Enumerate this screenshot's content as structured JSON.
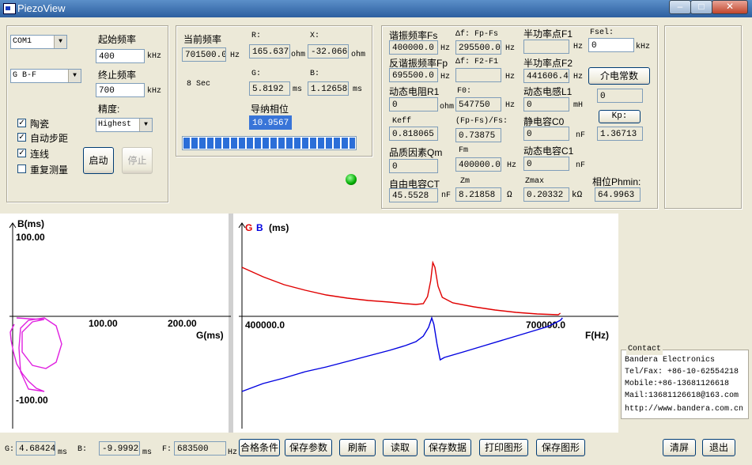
{
  "window": {
    "title": "PiezoView"
  },
  "controls": {
    "port": "COM1",
    "mode": "G B-F",
    "start_freq_label": "起始频率",
    "start_freq": "400",
    "end_freq_label": "终止频率",
    "end_freq": "700",
    "freq_unit": "kHz",
    "precision_label": "精度:",
    "precision": "Highest",
    "checks": [
      {
        "label": "陶瓷",
        "checked": true
      },
      {
        "label": "自动步距",
        "checked": true
      },
      {
        "label": "连线",
        "checked": true
      },
      {
        "label": "重复测量",
        "checked": false
      }
    ],
    "start_button": "启动",
    "stop_button": "停止"
  },
  "current": {
    "freq_label": "当前频率",
    "freq": "701500.0",
    "freq_unit": "Hz",
    "sec_label": "8 Sec",
    "r_label": "R:",
    "r": "165.637",
    "r_unit": "ohm",
    "x_label": "X:",
    "x": "-32.0667",
    "x_unit": "ohm",
    "g_label": "G:",
    "g": "5.8192",
    "g_unit": "ms",
    "b_label": "B:",
    "b": "1.12658",
    "b_unit": "ms",
    "phase_label": "导纳相位",
    "phase": "10.9567",
    "progress": 1.0
  },
  "results": {
    "fs_label": "谐振频率Fs",
    "fs": "400000.0",
    "fs_unit": "Hz",
    "df1_label": "Δf: Fp-Fs",
    "df1": "295500.0",
    "df1_unit": "Hz",
    "f1_label": "半功率点F1",
    "f1": "",
    "f1_unit": "Hz",
    "fsel_label": "Fsel:",
    "fsel": "0",
    "fsel_unit": "kHz",
    "fp_label": "反谐振频率Fp",
    "fp": "695500.0",
    "fp_unit": "Hz",
    "df2_label": "Δf: F2-F1",
    "df2": "",
    "df2_unit": "Hz",
    "f2_label": "半功率点F2",
    "f2": "441606.4",
    "f2_unit": "Hz",
    "dielectric_button": "介电常数",
    "r1_label": "动态电阻R1",
    "r1": "0",
    "r1_unit": "ohm",
    "f0_label": "F0:",
    "f0": "547750",
    "f0_unit": "Hz",
    "l1_label": "动态电感L1",
    "l1": "0",
    "l1_unit": "mH",
    "dielectric": "0",
    "keff_label": "Keff",
    "keff": "0.818065",
    "ratio_label": "(Fp-Fs)/Fs:",
    "ratio": "0.73875",
    "c0_label": "静电容C0",
    "c0": "0",
    "c0_unit": "nF",
    "kp_button": "Kp:",
    "kp": "1.36713",
    "qm_label": "品质因素Qm",
    "qm": "0",
    "fm_label": "Fm",
    "fm": "400000.0",
    "fm_unit": "Hz",
    "c1_label": "动态电容C1",
    "c1": "0",
    "c1_unit": "nF",
    "ct_label": "自由电容CT",
    "ct": "45.5528",
    "ct_unit": "nF",
    "zm_label": "Zm",
    "zm": "8.21858",
    "zm_unit": "Ω",
    "zmax_label": "Zmax",
    "zmax": "0.20332",
    "zmax_unit": "kΩ",
    "phmin_label": "相位Phmin:",
    "phmin": "64.9963"
  },
  "chart_data": [
    {
      "type": "scatter",
      "ylabel": "B(ms)",
      "xlabel": "G(ms)",
      "xticks": [
        "100.00",
        "200.00"
      ],
      "yticks": [
        "100.00",
        "-100.00"
      ],
      "xlim": [
        0,
        250
      ],
      "ylim": [
        -100,
        100
      ],
      "series": [
        {
          "color": "#e020e0",
          "points": [
            [
              2,
              -10
            ],
            [
              0,
              -14
            ],
            [
              -3,
              -20
            ],
            [
              -2,
              -30
            ],
            [
              1,
              -45
            ],
            [
              5,
              -60
            ],
            [
              12,
              -72
            ],
            [
              20,
              -82
            ],
            [
              30,
              -91
            ],
            [
              40,
              -95
            ],
            [
              20,
              -92
            ],
            [
              10,
              -70
            ],
            [
              8,
              -40
            ],
            [
              10,
              -15
            ],
            [
              20,
              -5
            ],
            [
              40,
              -2
            ],
            [
              55,
              -12
            ],
            [
              62,
              -35
            ],
            [
              55,
              -58
            ],
            [
              42,
              -66
            ],
            [
              25,
              -62
            ],
            [
              12,
              -45
            ],
            [
              12,
              -20
            ],
            [
              25,
              -7
            ],
            [
              40,
              -4
            ],
            [
              20,
              -3
            ],
            [
              5,
              -2
            ]
          ]
        }
      ]
    },
    {
      "type": "line",
      "title_g": "G",
      "title_b": "B",
      "title_unit": "(ms)",
      "xlabel": "F(Hz)",
      "xticks": [
        "400000.0",
        "700000.0"
      ],
      "xlim": [
        400000,
        700000
      ],
      "series": [
        {
          "name": "G",
          "color": "#e00000",
          "points": [
            [
              400000,
              62
            ],
            [
              420000,
              50
            ],
            [
              440000,
              40
            ],
            [
              460000,
              33
            ],
            [
              480000,
              27
            ],
            [
              500000,
              23
            ],
            [
              520000,
              20
            ],
            [
              540000,
              18
            ],
            [
              555000,
              16
            ],
            [
              565000,
              15
            ],
            [
              572000,
              16
            ],
            [
              576000,
              25
            ],
            [
              579000,
              45
            ],
            [
              581000,
              68
            ],
            [
              583000,
              62
            ],
            [
              586000,
              38
            ],
            [
              590000,
              24
            ],
            [
              600000,
              17
            ],
            [
              620000,
              12
            ],
            [
              640000,
              8
            ],
            [
              660000,
              5
            ],
            [
              680000,
              3
            ],
            [
              700000,
              2
            ],
            [
              702000,
              4
            ]
          ]
        },
        {
          "name": "B",
          "color": "#0000e0",
          "points": [
            [
              400000,
              -95
            ],
            [
              420000,
              -85
            ],
            [
              440000,
              -78
            ],
            [
              460000,
              -70
            ],
            [
              480000,
              -64
            ],
            [
              500000,
              -57
            ],
            [
              520000,
              -50
            ],
            [
              540000,
              -43
            ],
            [
              555000,
              -37
            ],
            [
              565000,
              -32
            ],
            [
              572000,
              -25
            ],
            [
              577000,
              -14
            ],
            [
              580000,
              -2
            ],
            [
              582000,
              -10
            ],
            [
              585000,
              -35
            ],
            [
              588000,
              -55
            ],
            [
              592000,
              -52
            ],
            [
              610000,
              -45
            ],
            [
              630000,
              -37
            ],
            [
              650000,
              -29
            ],
            [
              670000,
              -21
            ],
            [
              690000,
              -13
            ],
            [
              702000,
              -5
            ],
            [
              704000,
              -2
            ]
          ]
        }
      ]
    }
  ],
  "contact": {
    "title": "Contact",
    "lines": [
      "Bandera Electronics",
      "Tel/Fax: +86-10-62554218",
      "Mobile:+86-13681126618",
      "Mail:13681126618@163.com",
      "http://www.bandera.com.cn"
    ]
  },
  "statusbar": {
    "g_label": "G:",
    "g": "4.68424",
    "g_unit": "ms",
    "b_label": "B:",
    "b": "-9.99924",
    "b_unit": "ms",
    "f_label": "F:",
    "f": "683500",
    "f_unit": "Hz",
    "buttons": [
      "合格条件",
      "保存参数",
      "刷新",
      "读取",
      "保存数据",
      "打印图形",
      "保存图形"
    ],
    "clear_button": "清屏",
    "exit_button": "退出"
  }
}
